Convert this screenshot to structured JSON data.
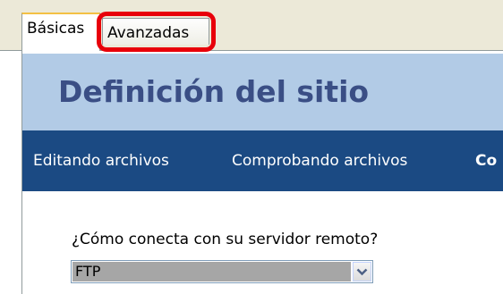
{
  "tabs": {
    "basic_label": "Básicas",
    "advanced_label": "Avanzadas",
    "selected": "Básicas",
    "highlighted": "Avanzadas"
  },
  "panel": {
    "title": "Definición del sitio",
    "nav": [
      "Editando archivos",
      "Comprobando archivos",
      "Co"
    ]
  },
  "form": {
    "question": "¿Cómo conecta con su servidor remoto?",
    "connection_value": "FTP"
  },
  "icons": {
    "dropdown": "chevron-down-icon"
  },
  "colors": {
    "header_background": "#b2cbe6",
    "title_text": "#3a4e85",
    "nav_background": "#1b4a83",
    "highlight_ring": "#e8000a",
    "selected_option_background": "#a6a6a6"
  }
}
